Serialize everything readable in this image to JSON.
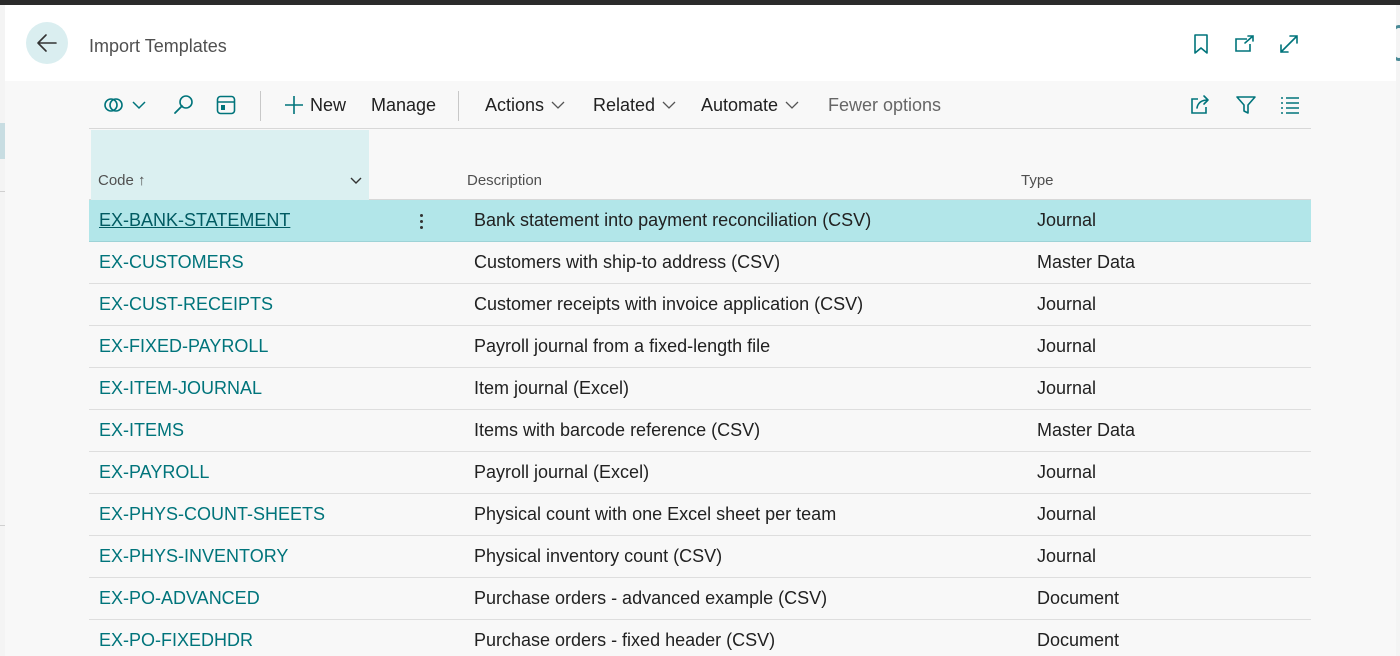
{
  "header": {
    "title": "Import Templates",
    "back_icon": "arrow-left-icon",
    "icons": [
      "bookmark-icon",
      "open-in-new-window-icon",
      "expand-icon"
    ]
  },
  "toolbar": {
    "left_icons": [
      "views-icon",
      "search-icon",
      "edit-list-icon"
    ],
    "new_label": "New",
    "manage_label": "Manage",
    "actions_label": "Actions",
    "related_label": "Related",
    "automate_label": "Automate",
    "fewer_options_label": "Fewer options",
    "right_icons": [
      "share-icon",
      "filter-icon",
      "list-view-icon"
    ]
  },
  "table": {
    "columns": {
      "code": "Code ↑",
      "description": "Description",
      "type": "Type"
    },
    "rows": [
      {
        "code": "EX-BANK-STATEMENT",
        "description": "Bank statement into payment reconciliation (CSV)",
        "type": "Journal",
        "selected": true
      },
      {
        "code": "EX-CUSTOMERS",
        "description": "Customers with ship-to address (CSV)",
        "type": "Master Data"
      },
      {
        "code": "EX-CUST-RECEIPTS",
        "description": "Customer receipts with invoice application (CSV)",
        "type": "Journal"
      },
      {
        "code": "EX-FIXED-PAYROLL",
        "description": "Payroll journal from a fixed-length file",
        "type": "Journal"
      },
      {
        "code": "EX-ITEM-JOURNAL",
        "description": "Item journal (Excel)",
        "type": "Journal"
      },
      {
        "code": "EX-ITEMS",
        "description": "Items with barcode reference (CSV)",
        "type": "Master Data"
      },
      {
        "code": "EX-PAYROLL",
        "description": "Payroll journal (Excel)",
        "type": "Journal"
      },
      {
        "code": "EX-PHYS-COUNT-SHEETS",
        "description": "Physical count with one Excel sheet per team",
        "type": "Journal"
      },
      {
        "code": "EX-PHYS-INVENTORY",
        "description": "Physical inventory count (CSV)",
        "type": "Journal"
      },
      {
        "code": "EX-PO-ADVANCED",
        "description": "Purchase orders - advanced example (CSV)",
        "type": "Document"
      },
      {
        "code": "EX-PO-FIXEDHDR",
        "description": "Purchase orders - fixed header (CSV)",
        "type": "Document"
      }
    ]
  },
  "colors": {
    "accent": "#00747b",
    "selected_row": "#b2e6e9",
    "sorted_column_header": "#dbf0f1"
  }
}
